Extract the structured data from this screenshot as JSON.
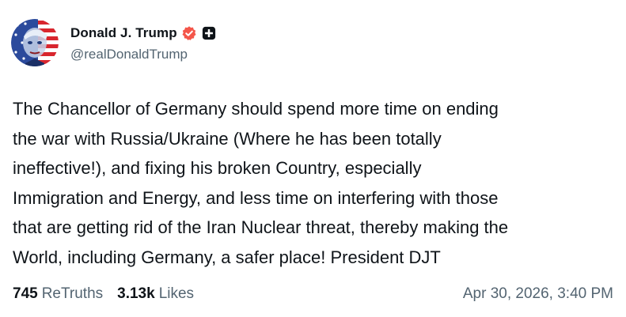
{
  "author": {
    "display_name": "Donald J. Trump",
    "handle": "@realDonaldTrump",
    "avatar_icon": "avatar-flag-portrait-icon",
    "verified_icon": "verified-badge-icon",
    "extra_icon": "plus-icon",
    "verified_color": "#f4564a"
  },
  "post": {
    "text": "The Chancellor of Germany should spend more time on ending\nthe war with Russia/Ukraine (Where he has been totally\nineffective!), and fixing his broken Country, especially\nImmigration and Energy, and less time on interfering with those\nthat are getting rid of the Iran Nuclear threat, thereby making the\nWorld, including Germany, a safer place! President DJT"
  },
  "stats": {
    "retruths_count": "745",
    "retruths_label": "ReTruths",
    "likes_count": "3.13k",
    "likes_label": "Likes",
    "timestamp": "Apr 30, 2026, 3:40 PM"
  }
}
